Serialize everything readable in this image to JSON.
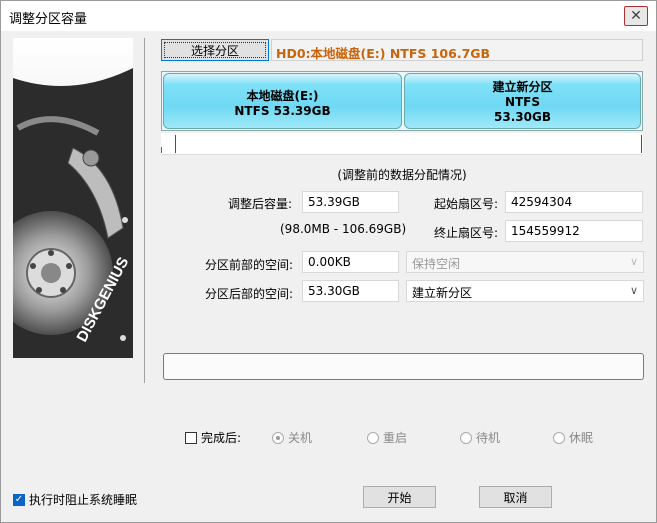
{
  "window": {
    "title": "调整分区容量",
    "close_glyph": "✕"
  },
  "sidebar": {
    "logo_text": "DISKGENIUS"
  },
  "top": {
    "select_partition_label": "选择分区",
    "disk_info": "HD0:本地磁盘(E:) NTFS 106.7GB"
  },
  "partitions": [
    {
      "line1": "本地磁盘(E:)",
      "line2": "NTFS 53.39GB"
    },
    {
      "line1": "建立新分区",
      "line2": "NTFS",
      "line3": "53.30GB"
    }
  ],
  "caption": "(调整前的数据分配情况)",
  "form": {
    "resized_label": "调整后容量:",
    "resized_value": "53.39GB",
    "range_text": "(98.0MB - 106.69GB)",
    "start_sector_label": "起始扇区号:",
    "start_sector_value": "42594304",
    "end_sector_label": "终止扇区号:",
    "end_sector_value": "154559912",
    "before_space_label": "分区前部的空间:",
    "before_space_value": "0.00KB",
    "before_space_option": "保持空闲",
    "after_space_label": "分区后部的空间:",
    "after_space_value": "53.30GB",
    "after_space_option": "建立新分区",
    "arrow_glyph": "∨"
  },
  "options": {
    "after_complete_label": "完成后:",
    "radios": [
      "关机",
      "重启",
      "待机",
      "休眠"
    ],
    "selected_radio": "关机",
    "prevent_sleep_label": "执行时阻止系统睡眠",
    "prevent_sleep_checked": true,
    "check_glyph": "✓"
  },
  "buttons": {
    "start": "开始",
    "cancel": "取消"
  },
  "colors": {
    "accent": "#0078d7",
    "partition": "#6fd8f3",
    "disk_info_text": "#c8640a"
  }
}
